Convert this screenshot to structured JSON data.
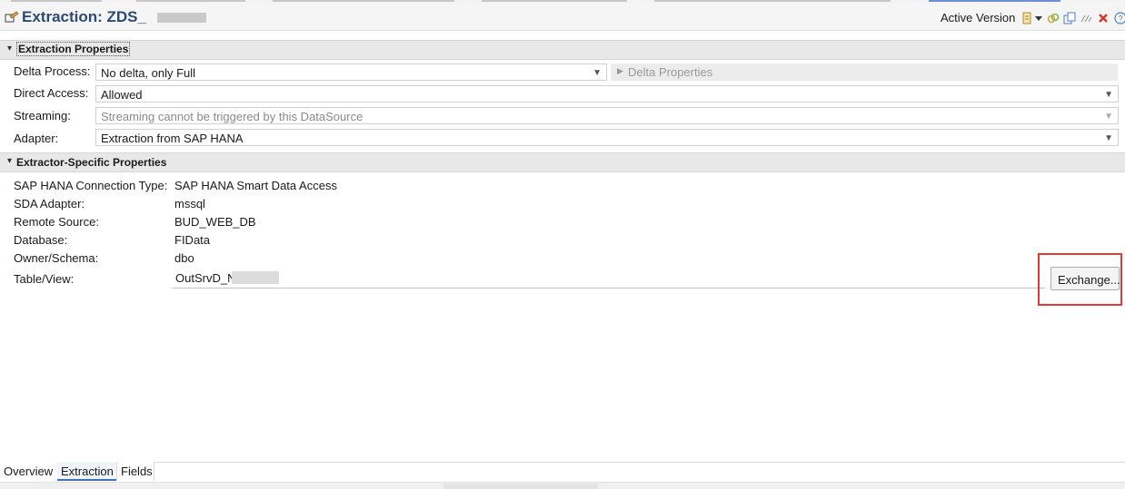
{
  "editor": {
    "title": "Extraction: ZDS_",
    "active_version": "Active Version"
  },
  "extraction_properties": {
    "title": "Extraction Properties",
    "delta_process_label": "Delta Process:",
    "delta_process_value": "No delta, only Full",
    "delta_properties_label": "Delta Properties",
    "direct_access_label": "Direct Access:",
    "direct_access_value": "Allowed",
    "streaming_label": "Streaming:",
    "streaming_value": "Streaming cannot be triggered by this DataSource",
    "adapter_label": "Adapter:",
    "adapter_value": "Extraction from SAP HANA"
  },
  "extractor_specific": {
    "title": "Extractor-Specific Properties",
    "rows": [
      {
        "label": "SAP HANA Connection Type:",
        "value": "SAP HANA Smart Data Access"
      },
      {
        "label": "SDA Adapter:",
        "value": "mssql"
      },
      {
        "label": "Remote Source:",
        "value": "BUD_WEB_DB"
      },
      {
        "label": "Database:",
        "value": "FIData"
      },
      {
        "label": "Owner/Schema:",
        "value": "dbo"
      }
    ],
    "table_view_label": "Table/View:",
    "table_view_value": "OutSrvD_N",
    "exchange_button": "Exchange..."
  },
  "bottom_tabs": [
    {
      "label": "Overview"
    },
    {
      "label": "Extraction"
    },
    {
      "label": "Fields"
    }
  ],
  "colors": {
    "title": "#2d4a73",
    "highlight_box": "#e53935",
    "active_tab": "#3b73c4"
  },
  "icons": {
    "title_icon": "datasource-icon",
    "toolbar": [
      "activate-icon",
      "dropdown-icon",
      "link-icon",
      "compare-icon",
      "toggle-icon",
      "delete-icon",
      "help-icon"
    ]
  }
}
